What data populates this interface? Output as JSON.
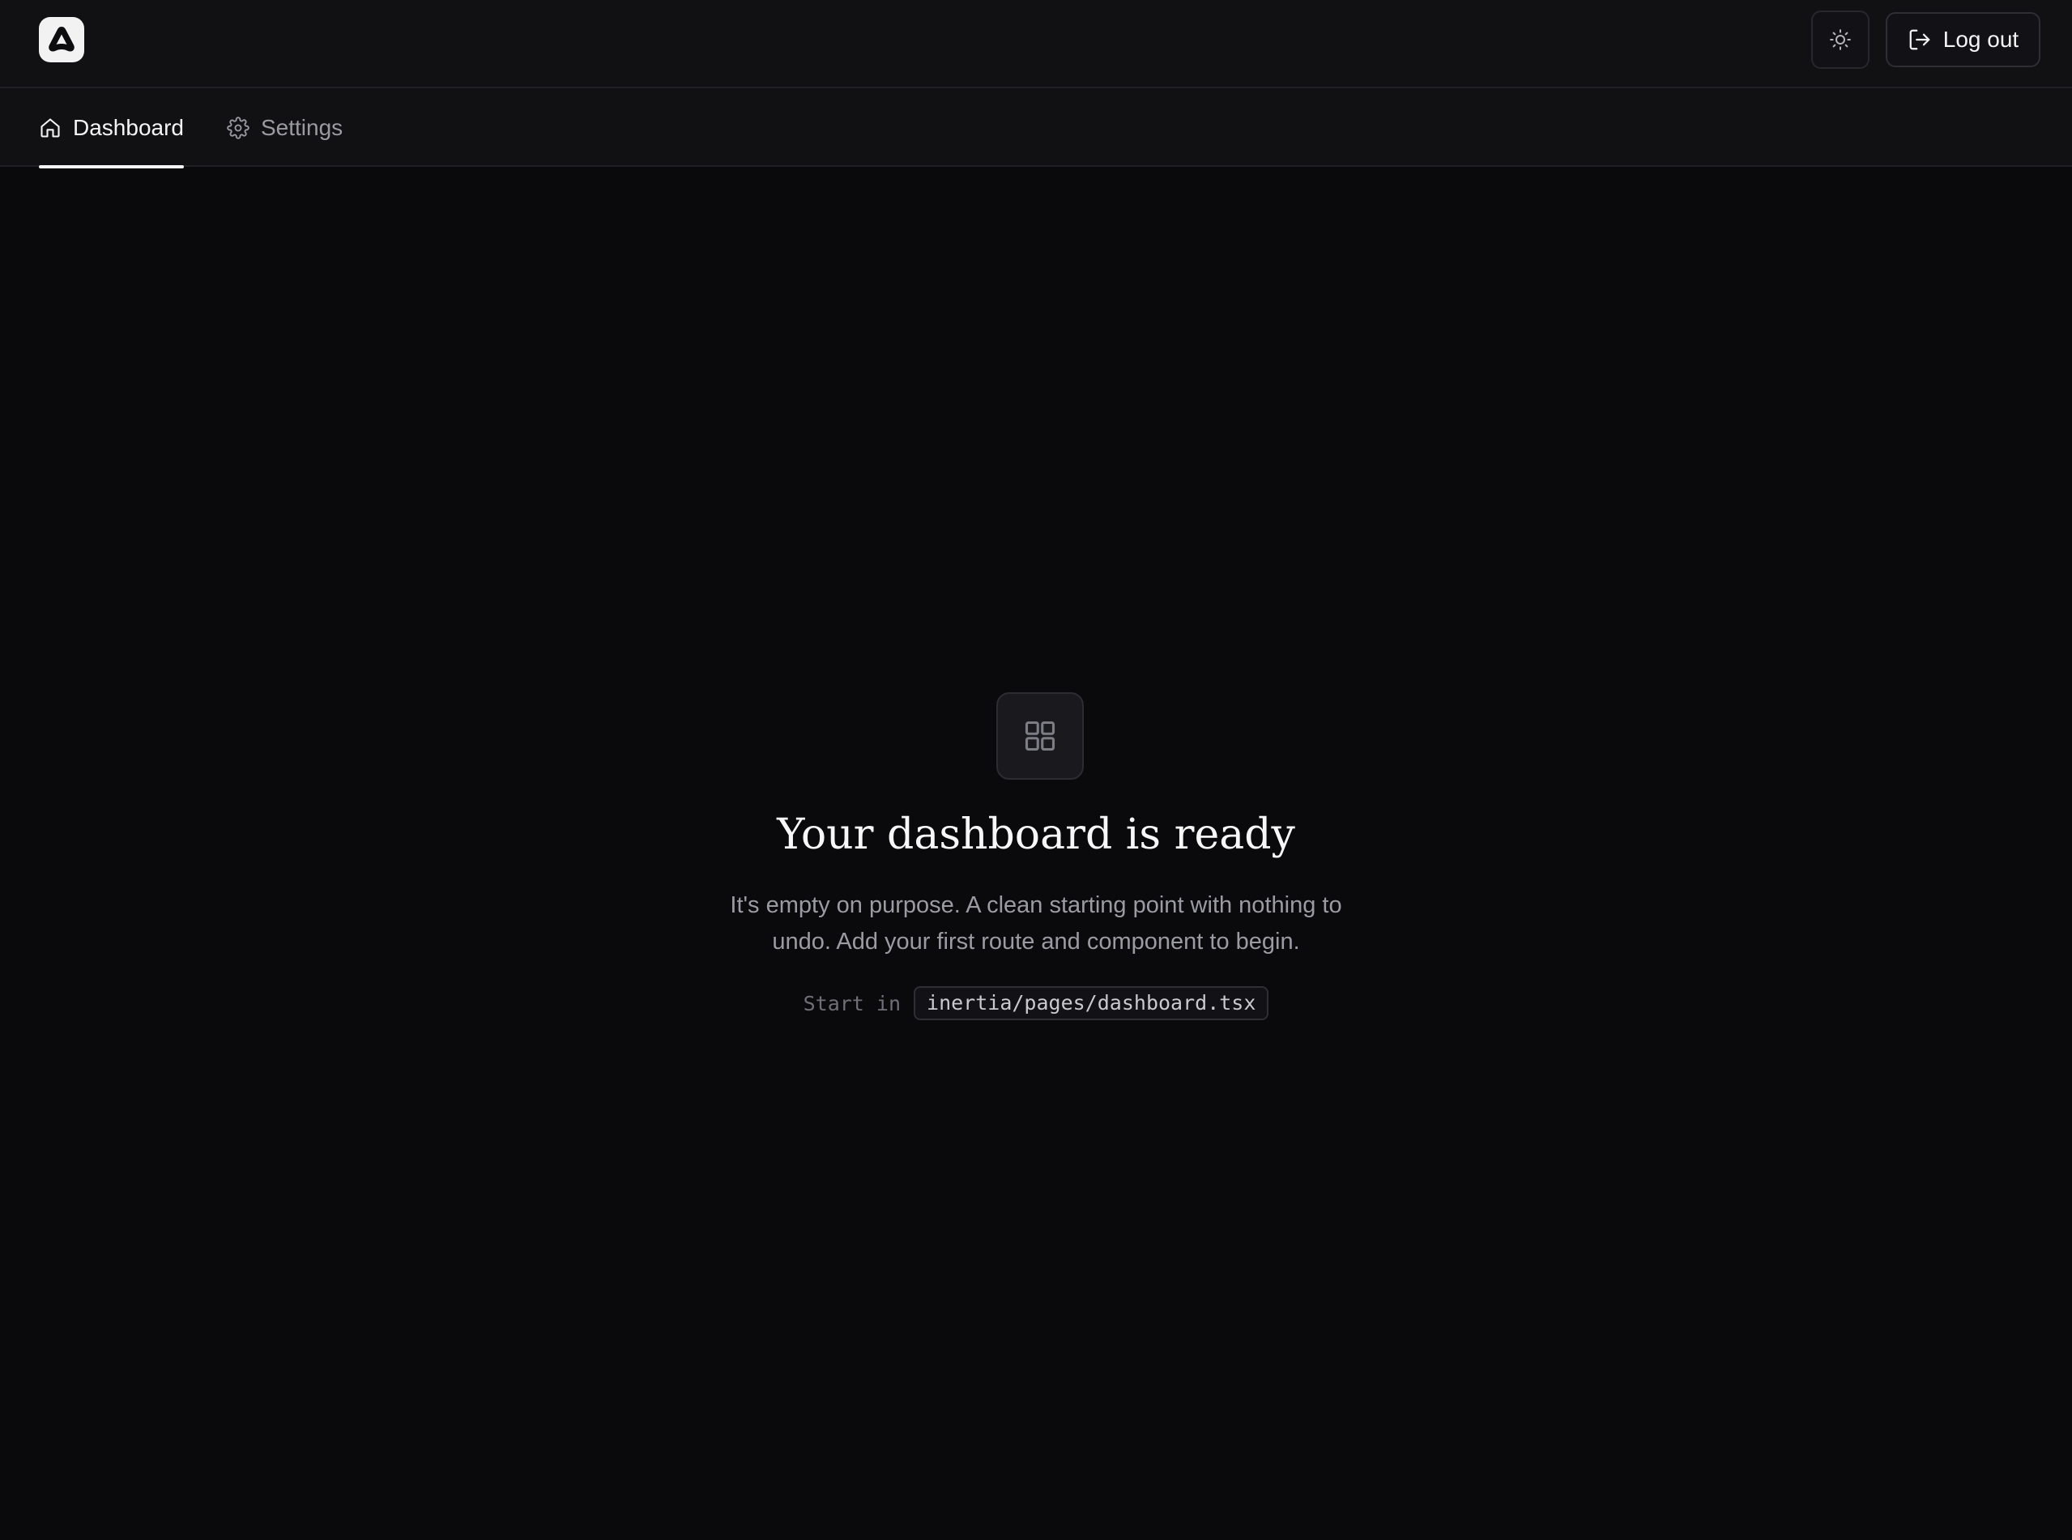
{
  "header": {
    "logo_icon": "triangle-logo-icon",
    "theme_toggle_icon": "sun-icon",
    "logout": {
      "icon": "log-out-icon",
      "label": "Log out"
    }
  },
  "nav": {
    "tabs": [
      {
        "label": "Dashboard",
        "icon": "home-icon",
        "active": true
      },
      {
        "label": "Settings",
        "icon": "gear-icon",
        "active": false
      }
    ]
  },
  "empty_state": {
    "icon": "grid-icon",
    "title": "Your dashboard is ready",
    "description": "It's empty on purpose. A clean starting point with nothing to undo. Add your first route and component to begin.",
    "start_label": "Start in",
    "start_path": "inertia/pages/dashboard.tsx"
  },
  "colors": {
    "background": "#0a0a0d",
    "header_background": "#111114",
    "border": "#1f1f24",
    "text_primary": "#f4f4f5",
    "text_muted": "#9b9ba3"
  }
}
